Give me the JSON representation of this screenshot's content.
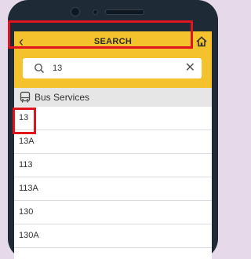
{
  "header": {
    "title": "SEARCH",
    "back_icon": "chevron-left-icon",
    "home_icon": "home-icon",
    "accent": "#f3c22d"
  },
  "search": {
    "value": "13",
    "clear_symbol": "✕"
  },
  "section": {
    "label": "Bus Services"
  },
  "results": [
    "13",
    "13A",
    "113",
    "113A",
    "130",
    "130A"
  ],
  "highlight_color": "#e0141c"
}
